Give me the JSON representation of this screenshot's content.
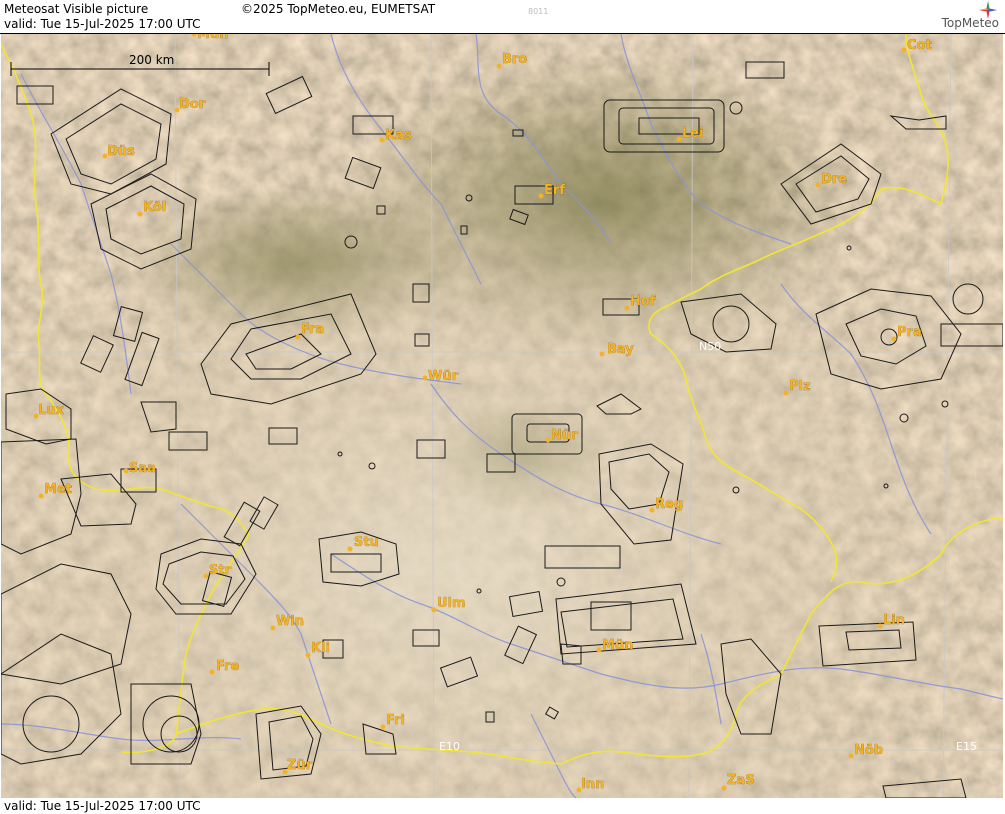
{
  "header": {
    "title": "Meteosat Visible picture",
    "copyright": "©2025 TopMeteo.eu, EUMETSAT",
    "valid": "valid:  Tue  15-Jul-2025  17:00 UTC",
    "image_id": "8011",
    "brand": "TopMeteo"
  },
  "footer": {
    "valid": "valid:  Tue  15-Jul-2025  17:00 UTC"
  },
  "map": {
    "scale_label": "200 km",
    "colors": {
      "border": "#f2e632",
      "river": "#8a95d8",
      "airspace": "#1a1a1a",
      "grid": "#c8c8c8",
      "city_dot": "#f3b324",
      "city_label": "#f3b324"
    },
    "cities": [
      {
        "id": "mun-nw",
        "label": "Mün"
      },
      {
        "id": "bro",
        "label": "Bro"
      },
      {
        "id": "cot",
        "label": "Cot"
      },
      {
        "id": "dor",
        "label": "Dor"
      },
      {
        "id": "kas",
        "label": "Kas"
      },
      {
        "id": "lei",
        "label": "Lei"
      },
      {
        "id": "dus",
        "label": "Düs"
      },
      {
        "id": "dre",
        "label": "Dre"
      },
      {
        "id": "erf",
        "label": "Erf"
      },
      {
        "id": "kol",
        "label": "Köl"
      },
      {
        "id": "hof",
        "label": "Hof"
      },
      {
        "id": "fra",
        "label": "Fra"
      },
      {
        "id": "pra",
        "label": "Pra"
      },
      {
        "id": "bay",
        "label": "Bay"
      },
      {
        "id": "wur",
        "label": "Wür"
      },
      {
        "id": "plz",
        "label": "Plz"
      },
      {
        "id": "lux",
        "label": "Lux"
      },
      {
        "id": "nur",
        "label": "Nür"
      },
      {
        "id": "saa",
        "label": "Saa"
      },
      {
        "id": "met",
        "label": "Met"
      },
      {
        "id": "reg",
        "label": "Reg"
      },
      {
        "id": "stu",
        "label": "Stu"
      },
      {
        "id": "str",
        "label": "Str"
      },
      {
        "id": "ulm",
        "label": "Ulm"
      },
      {
        "id": "win",
        "label": "Win"
      },
      {
        "id": "lin",
        "label": "Lin"
      },
      {
        "id": "kli",
        "label": "Kli"
      },
      {
        "id": "mun",
        "label": "Mün"
      },
      {
        "id": "fre",
        "label": "Fre"
      },
      {
        "id": "fri",
        "label": "Fri"
      },
      {
        "id": "nob",
        "label": "Nöb"
      },
      {
        "id": "zur",
        "label": "Zür"
      },
      {
        "id": "inn",
        "label": "Inn"
      },
      {
        "id": "zas",
        "label": "ZaS"
      }
    ],
    "grid_labels": [
      {
        "id": "n50",
        "label": "N50"
      },
      {
        "id": "e10",
        "label": "E10"
      },
      {
        "id": "e15",
        "label": "E15"
      }
    ]
  }
}
